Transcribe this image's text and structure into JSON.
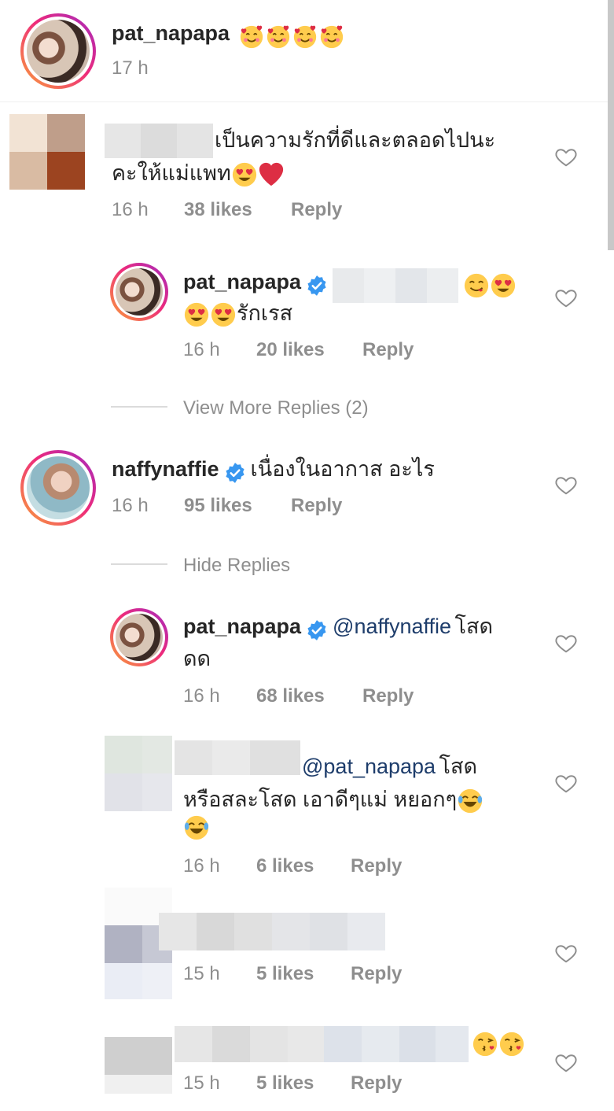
{
  "header": {
    "username": "pat_napapa",
    "caption_emojis": [
      "smiling-face-with-hearts",
      "smiling-face-with-hearts",
      "smiling-face-with-hearts",
      "smiling-face-with-hearts"
    ],
    "time": "17 h"
  },
  "comments": [
    {
      "id": "c1",
      "text_line1": "เป็นความรักที่ดีและตลอดไปนะ",
      "text_line2": "คะให้แม่แพท",
      "time": "16 h",
      "likes": "38 likes",
      "reply": "Reply"
    },
    {
      "id": "r1",
      "username": "pat_napapa",
      "text": "รักเรส",
      "time": "16 h",
      "likes": "20 likes",
      "reply": "Reply"
    },
    {
      "id": "c2",
      "username": "naffynaffie",
      "text": "เนื่องในอากาส อะไร",
      "time": "16 h",
      "likes": "95 likes",
      "reply": "Reply"
    },
    {
      "id": "r2",
      "username": "pat_napapa",
      "mention": "@naffynaffie",
      "text_after": "โสด",
      "text_line2": "ดด",
      "time": "16 h",
      "likes": "68 likes",
      "reply": "Reply"
    },
    {
      "id": "r3",
      "mention": "@pat_napapa",
      "text_after": "โสด",
      "text_line2": "หรือสละโสด เอาดีๆแม่ หยอกๆ",
      "time": "16 h",
      "likes": "6 likes",
      "reply": "Reply"
    },
    {
      "id": "r4",
      "time": "15 h",
      "likes": "5 likes",
      "reply": "Reply"
    },
    {
      "id": "r5",
      "time": "15 h",
      "likes": "5 likes",
      "reply": "Reply"
    }
  ],
  "view_more_replies": "View More Replies (2)",
  "hide_replies": "Hide Replies",
  "colors": {
    "verified": "#3897f0",
    "heart_red": "#ed4956",
    "mention": "#1e3d6b",
    "meta_gray": "#8e8e8e"
  }
}
